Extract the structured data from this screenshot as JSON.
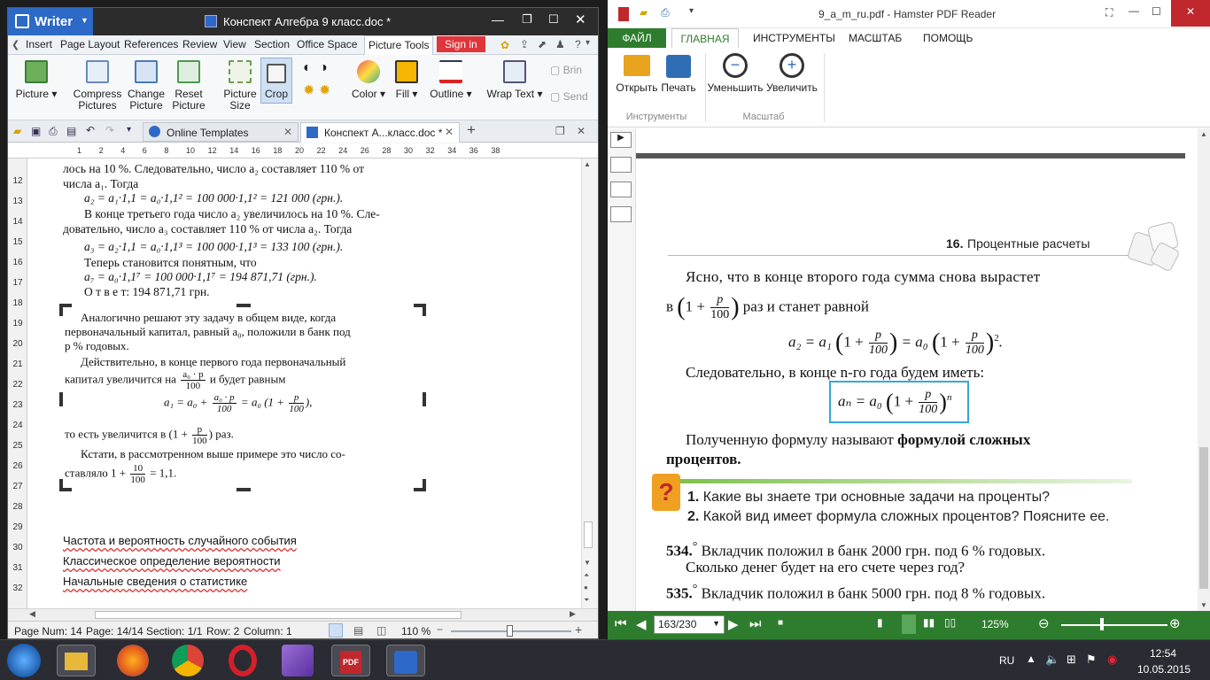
{
  "wps": {
    "app_name": "Writer",
    "window_title": "Конспект Алгебра 9 класс.doc *",
    "menu": [
      "Insert",
      "Page Layout",
      "References",
      "Review",
      "View",
      "Section",
      "Office Space",
      "Picture Tools"
    ],
    "sign_in": "Sign in",
    "ribbon": {
      "picture": "Picture",
      "compress_1": "Compress",
      "compress_2": "Pictures",
      "change_1": "Change",
      "change_2": "Picture",
      "reset_1": "Reset",
      "reset_2": "Picture",
      "size_1": "Picture",
      "size_2": "Size",
      "crop": "Crop",
      "color": "Color",
      "fill": "Fill",
      "outline": "Outline",
      "wrap": "Wrap Text",
      "bring": "Brin",
      "send": "Send"
    },
    "doc_tabs": [
      "Online Templates",
      "Конспект А...класс.doc *"
    ],
    "ruler_ticks": [
      "1",
      "2",
      "4",
      "6",
      "8",
      "10",
      "12",
      "14",
      "16",
      "18",
      "20",
      "22",
      "24",
      "26",
      "28",
      "30",
      "32",
      "34",
      "36",
      "38"
    ],
    "line_numbers": [
      "12",
      "13",
      "14",
      "15",
      "16",
      "17",
      "18",
      "19",
      "20",
      "21",
      "22",
      "23",
      "24",
      "25",
      "26",
      "27",
      "28",
      "29",
      "30",
      "31",
      "32"
    ],
    "text": {
      "l0": "лось на 10 %. Следовательно, число a₂ составляет 110 % от",
      "l1": "числа a₁. Тогда",
      "l2": "a₂ = a₁·1,1 = a₀·1,1² = 100 000·1,1² = 121 000 (грн.).",
      "l3": "В конце третьего года число a₂ увеличилось на 10 %. Сле-",
      "l4": "довательно, число a₃ составляет 110 % от числа a₂. Тогда",
      "l5": "a₃ = a₂·1,1 = a₀·1,1³ = 100 000·1,1³ = 133 100 (грн.).",
      "l6": "Теперь становится понятным, что",
      "l7": "a₇ = a₀·1,1⁷ = 100 000·1,1⁷ = 194 871,71 (грн.).",
      "l8": "О т в е т: 194 871,71 грн.",
      "p1": "Аналогично решают эту задачу в общем виде, когда",
      "p2": "первоначальный капитал, равный a₀, положили в банк под",
      "p3": "p % годовых.",
      "p4": "Действительно, в конце первого года первоначальный",
      "p5a": "капитал увеличится на",
      "p5b": "и будет равным",
      "p6": "a₁ = a₀ +",
      "p7a": "то есть увеличится в",
      "p7b": "раз.",
      "p8": "Кстати, в рассмотренном выше примере это число со-",
      "p9a": "ставляло 1 +",
      "p9b": "= 1,1.",
      "frac_num": "a₀ · p",
      "frac_den": "100",
      "p_num": "p",
      "ten": "10"
    },
    "links": [
      "Частота и вероятность случайного события",
      "Классическое определение вероятности",
      "Начальные сведения о статистике"
    ],
    "status": {
      "page_num": "Page Num: 14",
      "page": "Page: 14/14",
      "section": "Section: 1/1",
      "row": "Row: 2",
      "column": "Column: 1",
      "zoom": "110 %"
    }
  },
  "pdf": {
    "window_title": "9_a_m_ru.pdf - Hamster PDF Reader",
    "tabs": [
      "ФАЙЛ",
      "ГЛАВНАЯ",
      "ИНСТРУМЕНТЫ",
      "МАСШТАБ",
      "ПОМОЩЬ"
    ],
    "ribbon": {
      "open": "Открыть",
      "print": "Печать",
      "zoom_out": "Уменьшить",
      "zoom_in": "Увеличить",
      "group_tools": "Инструменты",
      "group_scale": "Масштаб"
    },
    "page": {
      "section_num": "16.",
      "section_title": "Процентные расчеты",
      "line1": "Ясно, что в конце второго года сумма снова вырастет",
      "line2a": "в",
      "line2b": "раз и станет равной",
      "formula1": "a₂ = a₁",
      "line3": "Следовательно, в конце n-го года будем иметь:",
      "formula_box": "aₙ = a₀",
      "line4a": "Полученную формулу называют",
      "line4b": "формулой сложных",
      "line5": "процентов",
      "q1_num": "1.",
      "q1": "Какие вы знаете три основные задачи на проценты?",
      "q2_num": "2.",
      "q2": "Какой вид имеет формула сложных процентов? Поясните ее.",
      "ex534_num": "534.",
      "ex534a": "Вкладчик положил в банк 2000 грн. под 6 % годовых.",
      "ex534b": "Сколько денег будет на его счете через год?",
      "ex535_num": "535.",
      "ex535a": "Вкладчик положил в банк 5000 грн. под 8 % годовых.",
      "hundred": "100",
      "p": "p",
      "exp2": "2",
      "expn": "n",
      "one_plus": "1 +"
    },
    "page_field": "163/230",
    "zoom": "125%"
  },
  "taskbar": {
    "lang": "RU",
    "time": "12:54",
    "date": "10.05.2015"
  }
}
